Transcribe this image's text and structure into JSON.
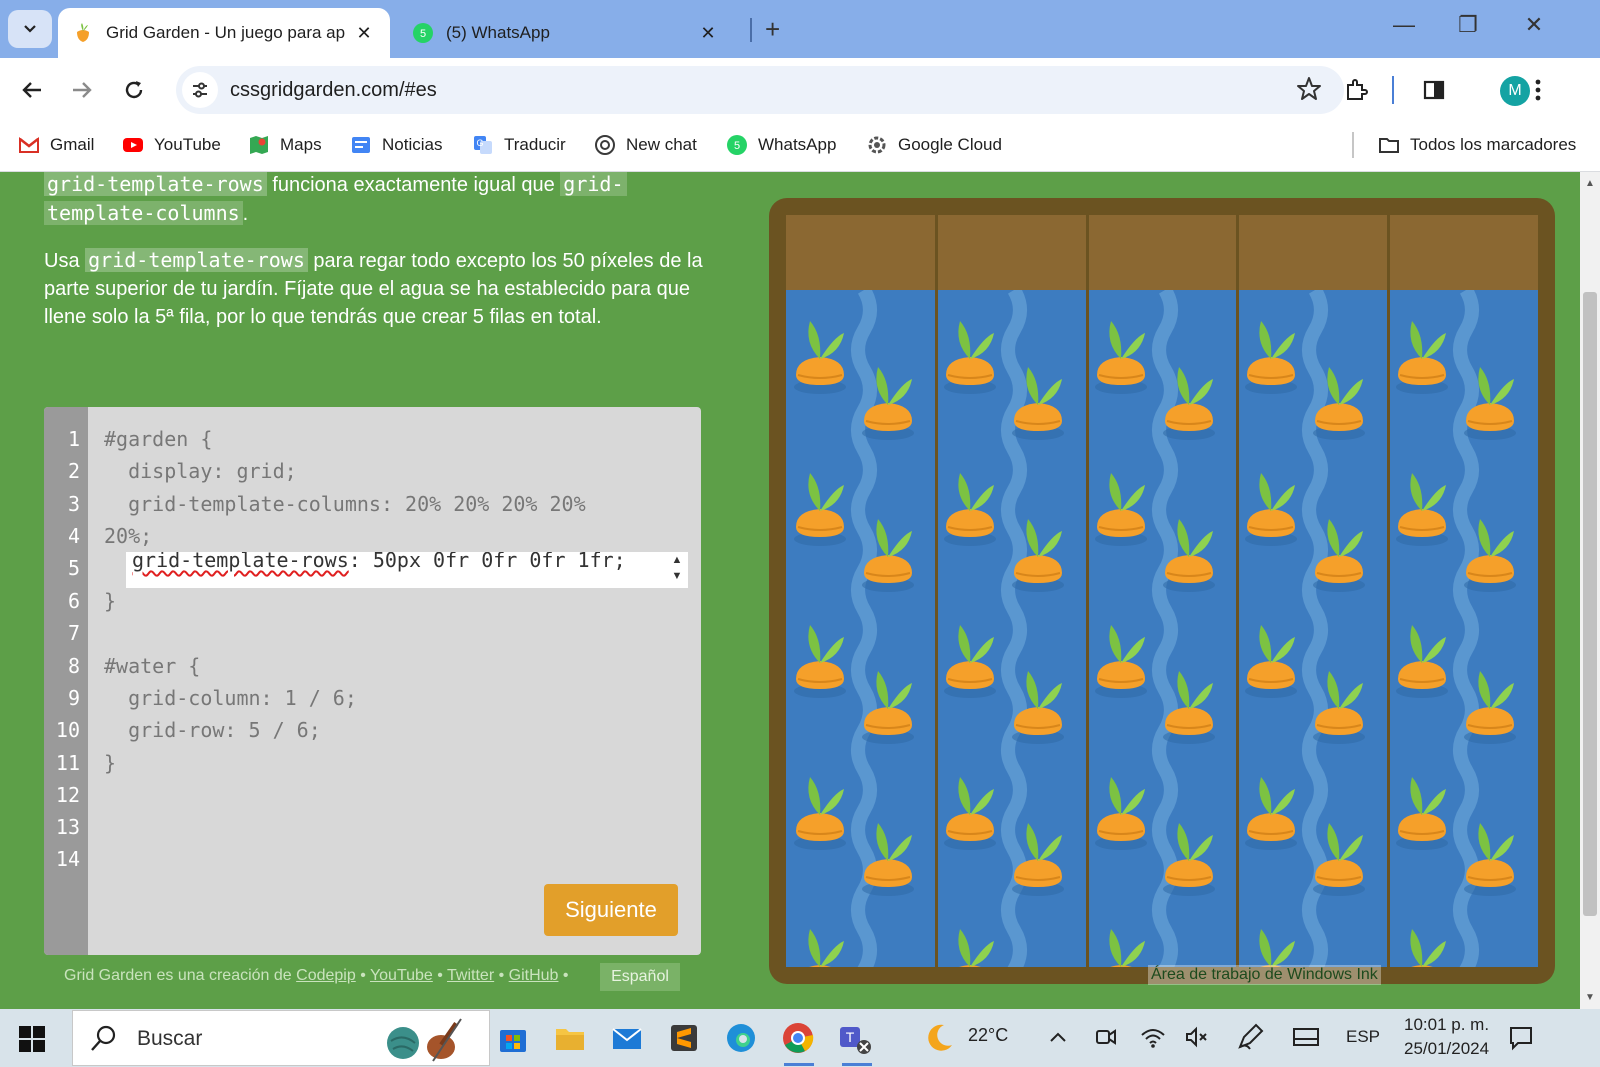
{
  "browser": {
    "tabs": [
      {
        "title": "Grid Garden - Un juego para ap",
        "active": true
      },
      {
        "title": "(5) WhatsApp",
        "active": false
      }
    ],
    "url": "cssgridgarden.com/#es",
    "profile_initial": "M",
    "bookmarks": [
      "Gmail",
      "YouTube",
      "Maps",
      "Noticias",
      "Traducir",
      "New chat",
      "WhatsApp",
      "Google Cloud"
    ],
    "all_bookmarks_label": "Todos los marcadores",
    "whatsapp_badge": "5"
  },
  "page": {
    "intro1": {
      "code1": "grid-template-rows",
      "text1": " funciona exactamente igual que ",
      "code2a": "grid-",
      "code2b": "template-columns",
      "text2": "."
    },
    "intro2": {
      "pre": "Usa ",
      "code": "grid-template-rows",
      "post": " para regar todo excepto los 50 píxeles de la parte superior de tu jardín. Fíjate que el agua se ha establecido para que llene solo la 5ª fila, por lo que tendrás que crear 5 filas en total."
    },
    "editor": {
      "line_numbers": [
        "1",
        "2",
        "3",
        "4",
        "5",
        "6",
        "7",
        "8",
        "9",
        "10",
        "11",
        "12",
        "13",
        "14"
      ],
      "lines": {
        "l1": "#garden {",
        "l2": "  display: grid;",
        "l3": "  grid-template-columns: 20% 20% 20% 20%",
        "l4": "20%;",
        "l6": "}",
        "l8": "#water {",
        "l9": "  grid-column: 1 / 6;",
        "l10": "  grid-row: 5 / 6;",
        "l11": "}"
      },
      "input_prop": "grid-template-rows",
      "input_rest": ": 50px 0fr 0fr 0fr 1fr;",
      "next_label": "Siguiente"
    },
    "footer": {
      "prefix": "Grid Garden es una creación de ",
      "codepip": "Codepip",
      "youtube": "YouTube",
      "twitter": "Twitter",
      "github": "GitHub",
      "sep": " • ",
      "language": "Español"
    },
    "ink_label": "Área de trabajo de Windows Ink"
  },
  "taskbar": {
    "search_placeholder": "Buscar",
    "weather": "22°C",
    "language": "ESP",
    "time": "10:01 p. m.",
    "date": "25/01/2024"
  },
  "colors": {
    "page_bg": "#5d9f48",
    "water": "#3d7cc0",
    "dirt": "#8b6832",
    "frame": "#6b5321",
    "carrot_orange": "#f5a02a",
    "leaf_green": "#7cc242",
    "next_button": "#e29f2a"
  }
}
